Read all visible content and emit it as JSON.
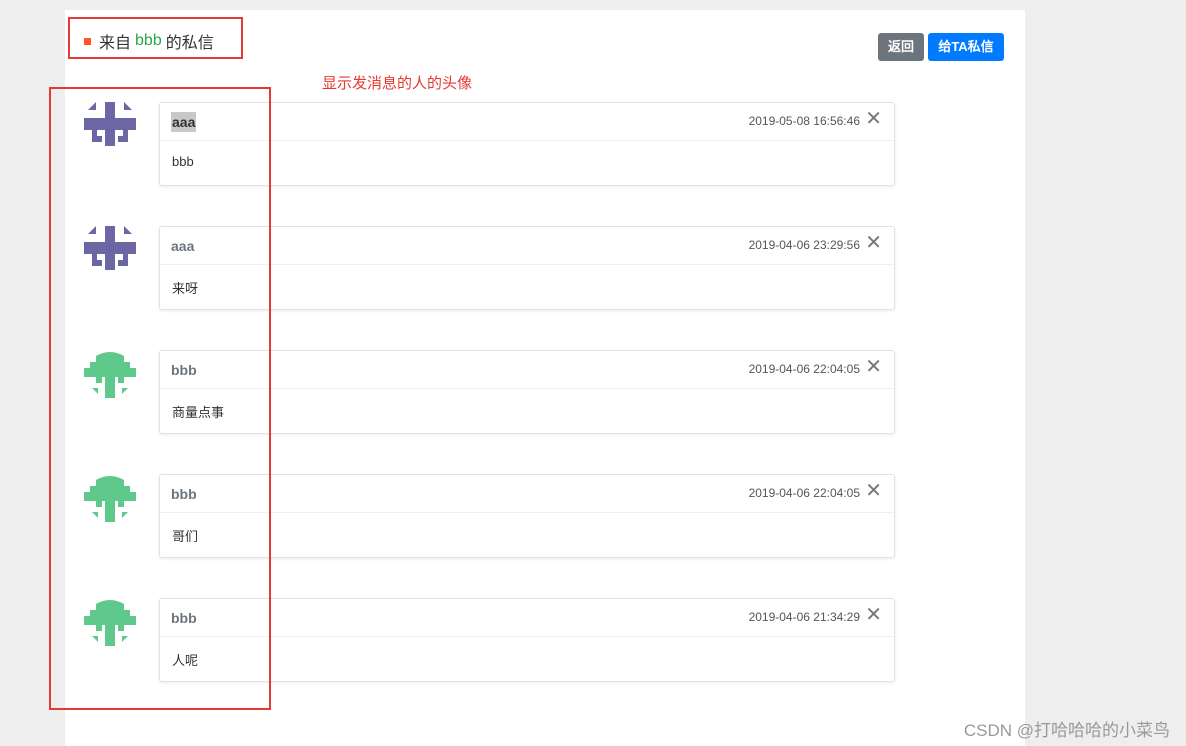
{
  "header": {
    "title_prefix": "来自",
    "title_name": "bbb",
    "title_suffix": "的私信",
    "back_label": "返回",
    "send_label": "给TA私信"
  },
  "annotation": "显示发消息的人的头像",
  "messages": [
    {
      "sender": "aaa",
      "time": "2019-05-08 16:56:46",
      "content": "bbb"
    },
    {
      "sender": "aaa",
      "time": "2019-04-06 23:29:56",
      "content": "来呀"
    },
    {
      "sender": "bbb",
      "time": "2019-04-06 22:04:05",
      "content": "商量点事"
    },
    {
      "sender": "bbb",
      "time": "2019-04-06 22:04:05",
      "content": "哥们"
    },
    {
      "sender": "bbb",
      "time": "2019-04-06 21:34:29",
      "content": "人呢"
    }
  ],
  "close_glyph": "✕",
  "watermark": "CSDN @打哈哈哈的小菜鸟",
  "colors": {
    "avatar_aaa": "#6c66a5",
    "avatar_bbb": "#5ec98a",
    "accent_green": "#28a745",
    "button_blue": "#007bff",
    "button_gray": "#6c757d",
    "annotation_red": "#e53935"
  }
}
